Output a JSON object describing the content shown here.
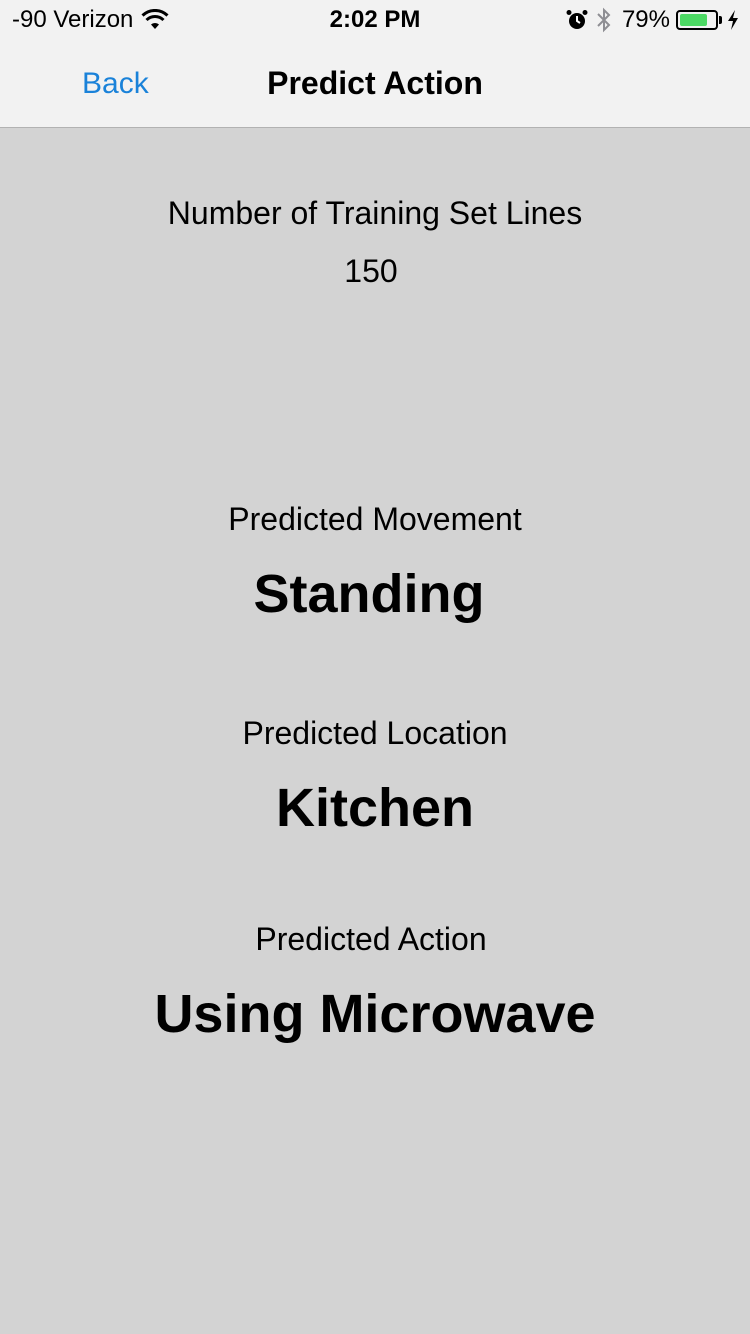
{
  "status_bar": {
    "carrier": "-90 Verizon",
    "time": "2:02 PM",
    "battery_percent_text": "79%",
    "battery_level": 0.79,
    "battery_color": "#4cd964",
    "icons": [
      "wifi-icon",
      "alarm-icon",
      "bluetooth-icon",
      "battery-icon",
      "charging-bolt-icon"
    ]
  },
  "nav": {
    "back_label": "Back",
    "title": "Predict Action",
    "accent_color": "#1a82d9"
  },
  "main": {
    "training_lines_label": "Number of Training Set Lines",
    "training_lines_value": "150",
    "movement_label": "Predicted Movement",
    "movement_value": "Standing",
    "location_label": "Predicted Location",
    "location_value": "Kitchen",
    "action_label": "Predicted Action",
    "action_value": "Using Microwave"
  }
}
